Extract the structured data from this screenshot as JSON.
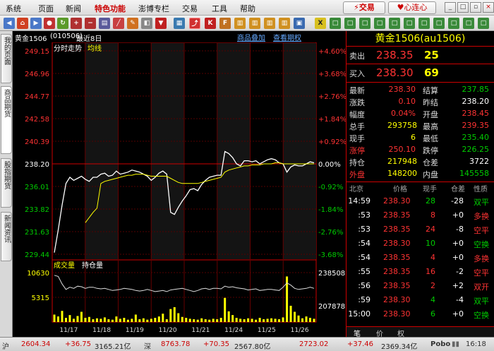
{
  "menu": [
    "系统",
    "页面",
    "新闻",
    "特色功能",
    "澎博专栏",
    "交易",
    "工具",
    "帮助"
  ],
  "active_menu": "特色功能",
  "trade_button": "交易",
  "heart_button": "心连心",
  "chart_header": {
    "name": "黄金1506",
    "code": "(010506)",
    "period": "最近8日",
    "add_btn": "商品叠加",
    "view_btn": "查看期权"
  },
  "chart_legend": {
    "title": "分时走势",
    "avg": "均线"
  },
  "vol_legend": {
    "vol": "成交量",
    "oi": "持仓量"
  },
  "side_tabs": [
    "我的页面",
    "商品期货",
    "股指期货",
    "新闻资讯"
  ],
  "chart_data": {
    "type": "line",
    "x": [
      "11/17",
      "11/18",
      "11/19",
      "11/20",
      "11/21",
      "11/24",
      "11/25",
      "11/26"
    ],
    "ylim": [
      229.44,
      249.15
    ],
    "price_ticks": [
      "249.15",
      "246.96",
      "244.77",
      "242.58",
      "240.39",
      "238.20",
      "236.01",
      "233.82",
      "231.63",
      "229.44"
    ],
    "pct_ticks": [
      "+4.60%",
      "+3.68%",
      "+2.76%",
      "+1.84%",
      "+0.92%",
      "0.00%",
      "-0.92%",
      "-1.84%",
      "-2.76%",
      "-3.68%"
    ],
    "price_series": [
      229.6,
      231.8,
      234.2,
      236.3,
      236.9,
      236.6,
      236.8,
      237.0,
      236.7,
      236.5,
      236.9,
      236.9,
      237.2,
      237.3,
      237.0,
      237.1,
      237.5,
      237.2,
      237.3,
      237.4,
      237.6,
      237.5,
      237.4,
      237.2,
      237.0,
      236.6,
      236.9,
      237.3,
      237.5,
      237.2,
      233.5,
      233.3,
      234.0,
      234.6,
      235.1,
      235.7,
      235.8,
      235.6,
      236.2,
      236.6,
      236.9,
      237.0,
      237.1,
      237.1,
      239.4,
      239.2,
      238.8,
      238.2,
      238.0,
      238.5,
      238.5,
      238.4,
      238.5,
      238.2,
      238.4,
      238.6,
      238.7,
      238.6,
      238.3,
      238.2,
      237.4,
      237.9,
      238.1,
      238.0,
      238.0,
      238.2,
      238.4,
      238.3
    ],
    "avg_series": [
      null,
      null,
      null,
      null,
      null,
      null,
      null,
      null,
      232.5,
      233.0,
      233.5,
      233.9,
      236.3,
      236.5,
      236.6,
      236.7,
      236.8,
      236.9,
      237.0,
      237.1,
      237.1,
      237.2,
      237.2,
      237.2,
      237.1,
      237.0,
      237.0,
      237.0,
      237.0,
      237.0,
      236.8,
      236.6,
      236.4,
      236.3,
      236.3,
      236.3,
      236.3,
      236.3,
      236.4,
      236.5,
      236.6,
      236.7,
      236.8,
      236.9,
      237.4,
      237.6,
      237.7,
      237.8,
      237.9,
      238.0,
      238.0,
      238.1,
      238.1,
      238.1,
      238.2,
      238.2,
      238.2,
      238.3,
      238.3,
      238.2,
      238.2,
      238.2,
      238.2,
      238.2,
      238.2,
      238.2,
      238.2,
      238.2
    ],
    "vol_ticks": [
      "10630",
      "5315"
    ],
    "oi_ticks": [
      "238508",
      "207878"
    ],
    "oi_series": [
      236000,
      235000,
      228000,
      223000,
      225000,
      224000,
      226000,
      225500,
      224000,
      225000,
      225000,
      224000,
      223500,
      224000,
      223000,
      222000,
      222500,
      223000,
      224000,
      223500,
      223000,
      222000,
      221500,
      222000,
      223000,
      222000,
      221000,
      221500,
      222000,
      221000,
      222500,
      223000,
      223500,
      224000,
      223000,
      222000,
      221000,
      222000,
      223500,
      224000,
      223000,
      224000,
      224000,
      223500,
      226000,
      225000,
      225500,
      224500,
      224000,
      223500,
      222500,
      223000,
      223500,
      222000,
      222500,
      223000,
      223000,
      222500,
      222000,
      225000,
      229000,
      227000,
      224000,
      223000,
      223500,
      224000,
      225000,
      224000
    ],
    "vol_series": [
      1600,
      1200,
      2400,
      900,
      1500,
      700,
      1300,
      2200,
      900,
      1100,
      600,
      800,
      700,
      1000,
      600,
      500,
      1200,
      700,
      900,
      500,
      700,
      1600,
      600,
      800,
      500,
      700,
      900,
      1200,
      1800,
      600,
      2800,
      3200,
      1900,
      1100,
      900,
      700,
      600,
      500,
      800,
      600,
      500,
      700,
      600,
      900,
      5200,
      2300,
      1500,
      900,
      700,
      600,
      800,
      700,
      500,
      900,
      600,
      700,
      800,
      700,
      600,
      1000,
      9800,
      3500,
      2200,
      1400,
      800,
      1200,
      900,
      700
    ]
  },
  "quote": {
    "title": "黄金1506(au1506)",
    "sell_label": "卖出",
    "sell_price": "238.35",
    "sell_vol": "25",
    "buy_label": "买入",
    "buy_price": "238.30",
    "buy_vol": "69",
    "left": [
      [
        "最新",
        "238.30"
      ],
      [
        "涨跌",
        "0.10"
      ],
      [
        "幅度",
        "0.04%"
      ],
      [
        "总手",
        "293758"
      ],
      [
        "现手",
        "6"
      ],
      [
        "涨停",
        "250.10"
      ],
      [
        "持仓",
        "217948"
      ],
      [
        "外盘",
        "148200"
      ]
    ],
    "right": [
      [
        "结算",
        "237.85"
      ],
      [
        "昨结",
        "238.20"
      ],
      [
        "开盘",
        "238.45"
      ],
      [
        "最高",
        "239.35"
      ],
      [
        "最低",
        "235.40"
      ],
      [
        "跌停",
        "226.25"
      ],
      [
        "仓差",
        "3722"
      ],
      [
        "内盘",
        "145558"
      ]
    ]
  },
  "ticks_header": [
    "北京",
    "价格",
    "现手",
    "仓差",
    "性质"
  ],
  "ticks": [
    [
      "14:59",
      "238.30",
      "28",
      "-28",
      "双平"
    ],
    [
      ":53",
      "238.35",
      "8",
      "+0",
      "多换"
    ],
    [
      ":53",
      "238.35",
      "24",
      "-8",
      "空平"
    ],
    [
      ":54",
      "238.30",
      "10",
      "+0",
      "空换"
    ],
    [
      ":54",
      "238.35",
      "4",
      "+0",
      "多换"
    ],
    [
      ":55",
      "238.35",
      "16",
      "-2",
      "空平"
    ],
    [
      ":56",
      "238.35",
      "2",
      "+2",
      "双开"
    ],
    [
      ":59",
      "238.30",
      "4",
      "-4",
      "双平"
    ],
    [
      "15:00",
      "238.30",
      "6",
      "+0",
      "空换"
    ]
  ],
  "right_tabs": [
    "笔",
    "价",
    "权"
  ],
  "status": {
    "sh_label": "沪",
    "sh_index": "2604.34",
    "sh_change": "+36.75",
    "sh_amount": "3165.21亿",
    "sz_label": "深",
    "sz_index": "8763.78",
    "sz_change": "+70.35",
    "sz_amount": "2567.80亿",
    "c_index": "2723.02",
    "c_change": "+37.46",
    "c_amount": "2369.34亿",
    "brand": "Pobo",
    "time": "16:18"
  }
}
